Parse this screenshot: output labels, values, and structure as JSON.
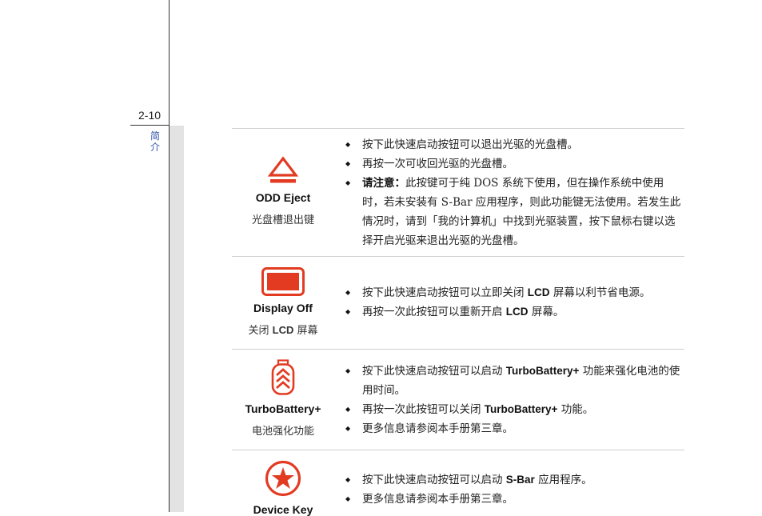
{
  "page": {
    "number": "2-10",
    "chapter_label": "简介"
  },
  "rows": [
    {
      "key_name": "ODD Eject",
      "key_sub": "光盘槽退出键",
      "icon": "eject-icon",
      "bullets": {
        "b1": "按下此快速启动按钮可以退出光驱的光盘槽。",
        "b2": "再按一次可收回光驱的光盘槽。",
        "b3_bold": "请注意：",
        "b3_text": "此按键可于纯 DOS 系统下使用，但在操作系统中使用时，若未安装有 S-Bar 应用程序，则此功能键无法使用。若发生此情况时，请到「我的计算机」中找到光驱装置，按下鼠标右键以选择开启光驱来退出光驱的光盘槽。"
      }
    },
    {
      "key_name": "Display Off",
      "key_sub_pre": "关闭 ",
      "key_sub_bold": "LCD",
      "key_sub_post": " 屏幕",
      "icon": "display-off-icon",
      "bullets": {
        "b1_pre": "按下此快速启动按钮可以立即关闭 ",
        "b1_bold": "LCD",
        "b1_post": " 屏幕以利节省电源。",
        "b2_pre": "再按一次此按钮可以重新开启 ",
        "b2_bold": "LCD",
        "b2_post": " 屏幕。"
      }
    },
    {
      "key_name": "TurboBattery+",
      "key_sub": "电池强化功能",
      "icon": "turbo-battery-icon",
      "bullets": {
        "b1_pre": "按下此快速启动按钮可以启动 ",
        "b1_bold": "TurboBattery+",
        "b1_post": " 功能来强化电池的使用时间。",
        "b2_pre": "再按一次此按钮可以关闭 ",
        "b2_bold": "TurboBattery+",
        "b2_post": " 功能。",
        "b3": "更多信息请参阅本手册第三章。"
      }
    },
    {
      "key_name": "Device Key",
      "icon": "star-icon",
      "bullets": {
        "b1_pre": "按下此快速启动按钮可以启动 ",
        "b1_bold": "S-Bar",
        "b1_post": " 应用程序。",
        "b2": "更多信息请参阅本手册第三章。"
      }
    }
  ],
  "colors": {
    "accent": "#e23b22",
    "divider": "#cfcfcf",
    "chapter_text": "#3355aa",
    "strip": "#e3e3e3"
  }
}
